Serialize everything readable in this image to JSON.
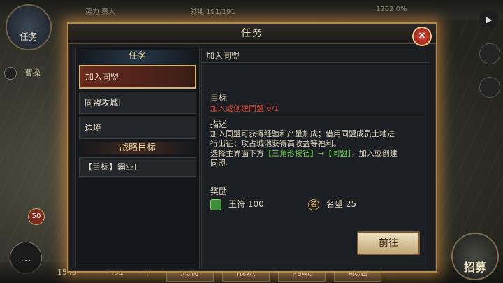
{
  "hud": {
    "top_left_button": "任务",
    "top_left_info": "势力 秦人",
    "top_mid_info": "领地 191/191",
    "top_right_info": "1262 0%",
    "cao_label": "曹操",
    "badge": "50",
    "res_copper": "1545",
    "res_jade": "401",
    "plus": "+",
    "tabs": [
      "武将",
      "战法",
      "内政",
      "城池"
    ],
    "recruit": "招募"
  },
  "modal": {
    "title": "任务",
    "close": "×",
    "left": {
      "header": "任务",
      "items": [
        "加入同盟",
        "同盟攻城I",
        "边境"
      ],
      "strategy_header": "战略目标",
      "goals": [
        "【目标】霸业I"
      ]
    },
    "right": {
      "title": "加入同盟",
      "goal_label": "目标",
      "goal_text": "加入或创建同盟  0/1",
      "desc_label": "描述",
      "desc_1": "加入同盟可获得经验和产量加成；借用同盟成员土地进行出征；攻占城池获得高收益等福利。",
      "desc_2a": "选择主界面下方",
      "desc_2b": "【三角形按钮】→【同盟】",
      "desc_2c": "，加入或创建同盟。",
      "reward_label": "奖励",
      "reward_1": "玉符 100",
      "reward_2": "名望 25",
      "fame_glyph": "名",
      "go_button": "前往"
    }
  }
}
